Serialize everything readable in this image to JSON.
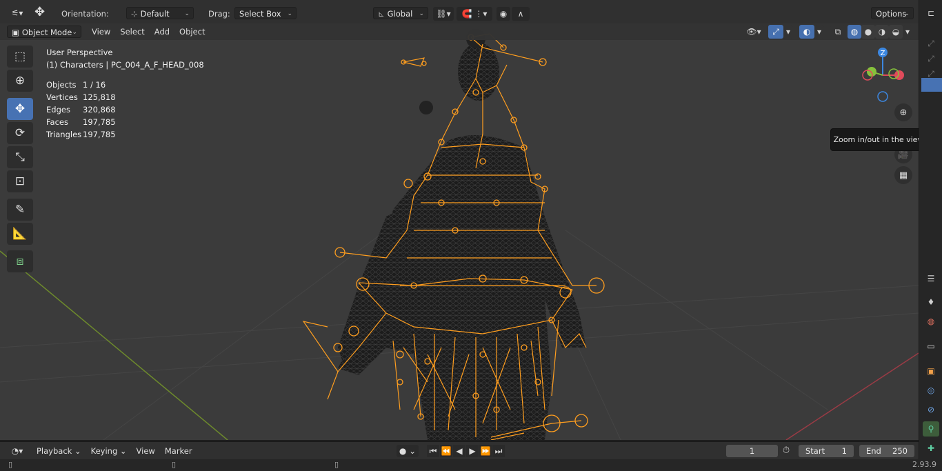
{
  "top_header": {
    "orientation_label": "Orientation:",
    "orientation_value": "Default",
    "drag_label": "Drag:",
    "drag_value": "Select Box",
    "transform_space": "Global",
    "options_label": "Options"
  },
  "viewport_header": {
    "mode": "Object Mode",
    "menus": [
      "View",
      "Select",
      "Add",
      "Object"
    ]
  },
  "overlay_info": {
    "view_name": "User Perspective",
    "collection_object": "(1) Characters | PC_004_A_F_HEAD_008",
    "stats": [
      {
        "label": "Objects",
        "value": "1 / 16"
      },
      {
        "label": "Vertices",
        "value": "125,818"
      },
      {
        "label": "Edges",
        "value": "320,868"
      },
      {
        "label": "Faces",
        "value": "197,785"
      },
      {
        "label": "Triangles",
        "value": "197,785"
      }
    ]
  },
  "tooltip": {
    "text": "Zoom in/out in the view"
  },
  "gizmo": {
    "z_label": "Z",
    "colors": {
      "x": "#e04b5b",
      "y": "#86c13c",
      "z": "#3c87e0"
    }
  },
  "timeline": {
    "menus": [
      "Playback",
      "Keying",
      "View",
      "Marker"
    ],
    "current_frame": "1",
    "start_label": "Start",
    "start_value": "1",
    "end_label": "End",
    "end_value": "250"
  },
  "status_bar": {
    "version": "2.93.9"
  },
  "colors": {
    "accent": "#4772b3",
    "armature": "#ff9e1f",
    "mesh": "#141414"
  },
  "icons": {
    "tools": [
      "select-box-icon",
      "cursor-icon",
      "move-icon",
      "rotate-icon",
      "scale-icon",
      "transform-icon",
      "annotate-icon",
      "measure-icon",
      "add-cube-icon"
    ]
  }
}
